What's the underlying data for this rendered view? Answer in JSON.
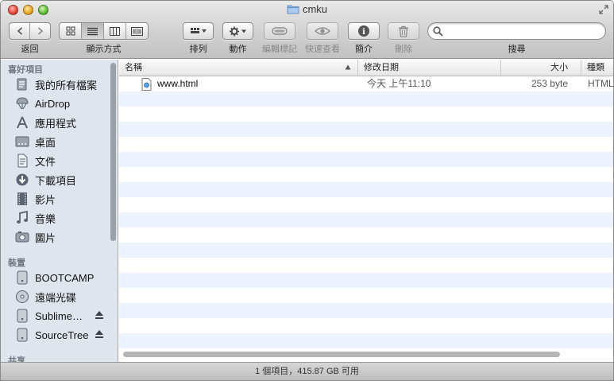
{
  "window": {
    "title": "cmku"
  },
  "toolbar": {
    "back_label": "返回",
    "view_label": "顯示方式",
    "arrange_label": "排列",
    "action_label": "動作",
    "edit_tags_label": "編輯標記",
    "quicklook_label": "快速查看",
    "info_label": "簡介",
    "delete_label": "刪除",
    "search_label": "搜尋",
    "search_value": ""
  },
  "sidebar": {
    "favorites_header": "喜好項目",
    "favorites": [
      {
        "label": "我的所有檔案",
        "icon": "all-files-icon"
      },
      {
        "label": "AirDrop",
        "icon": "airdrop-icon"
      },
      {
        "label": "應用程式",
        "icon": "applications-icon"
      },
      {
        "label": "桌面",
        "icon": "desktop-icon"
      },
      {
        "label": "文件",
        "icon": "documents-icon"
      },
      {
        "label": "下載項目",
        "icon": "downloads-icon"
      },
      {
        "label": "影片",
        "icon": "movies-icon"
      },
      {
        "label": "音樂",
        "icon": "music-icon"
      },
      {
        "label": "圖片",
        "icon": "pictures-icon"
      }
    ],
    "devices_header": "裝置",
    "devices": [
      {
        "label": "BOOTCAMP",
        "icon": "disk-icon"
      },
      {
        "label": "遠端光碟",
        "icon": "remote-disc-icon"
      },
      {
        "label": "Sublime…",
        "icon": "disk-icon",
        "eject": true
      },
      {
        "label": "SourceTree",
        "icon": "disk-icon",
        "eject": true
      }
    ],
    "shared_header": "共享"
  },
  "list": {
    "columns": {
      "name": "名稱",
      "modified": "修改日期",
      "size": "大小",
      "kind": "種類"
    },
    "files": [
      {
        "name": "www.html",
        "modified": "今天 上午11:10",
        "size": "253 byte",
        "kind": "HTML"
      }
    ]
  },
  "status": {
    "text": "1 個項目，415.87 GB 可用"
  }
}
